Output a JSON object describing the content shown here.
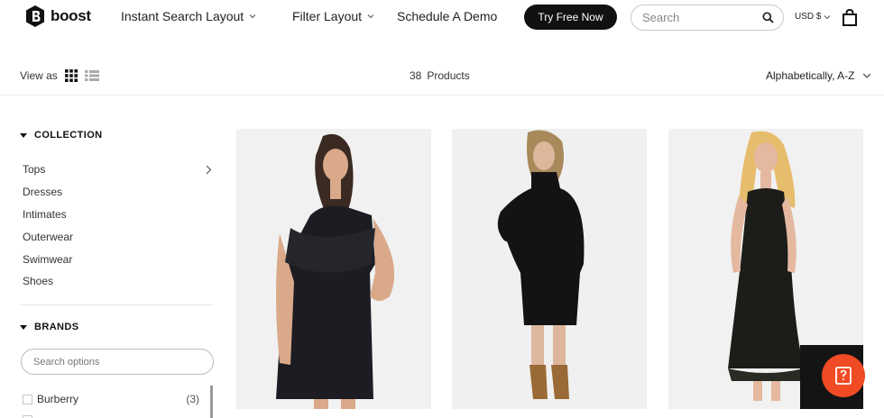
{
  "header": {
    "logo_text": "boost",
    "nav": [
      {
        "label": "Instant Search Layout"
      },
      {
        "label": "Filter Layout"
      },
      {
        "label": "Schedule A Demo"
      }
    ],
    "cta_label": "Try Free Now",
    "search_placeholder": "Search",
    "currency": "USD $"
  },
  "toolbar": {
    "view_as_label": "View as",
    "product_count": "38",
    "product_count_label": "Products",
    "sort_label": "Alphabetically, A-Z"
  },
  "sidebar": {
    "collection_title": "COLLECTION",
    "collection_items": [
      "Tops",
      "Dresses",
      "Intimates",
      "Outerwear",
      "Swimwear",
      "Shoes"
    ],
    "brands_title": "BRANDS",
    "brands_search_placeholder": "Search options",
    "brands": [
      {
        "name": "Burberry",
        "count": "(3)"
      }
    ]
  },
  "colors": {
    "accent": "#111111",
    "help_badge": "#f04b24",
    "card_bg": "#eeeeee"
  },
  "icons": [
    "search-icon",
    "cart-icon",
    "grid-view-icon",
    "list-view-icon",
    "chevron-down-icon",
    "chevron-right-icon",
    "help-icon"
  ]
}
